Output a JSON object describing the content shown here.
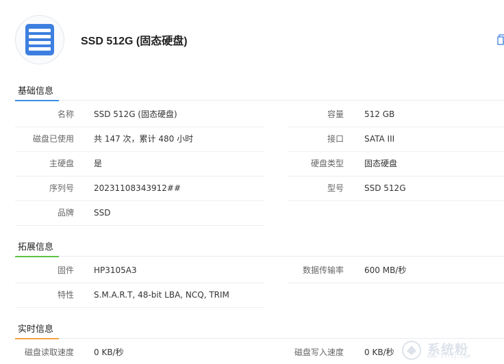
{
  "device": {
    "title": "SSD 512G (固态硬盘)",
    "icon": "ssd-icon",
    "accent": "#3d7fe0"
  },
  "sections": {
    "basic": {
      "title": "基础信息",
      "accent": "#3a8ee6",
      "rows": [
        {
          "l_label": "名称",
          "l_value": "SSD 512G (固态硬盘)",
          "r_label": "容量",
          "r_value": "512 GB"
        },
        {
          "l_label": "磁盘已使用",
          "l_value": "共 147 次，累计 480 小时",
          "r_label": "接口",
          "r_value": "SATA III"
        },
        {
          "l_label": "主硬盘",
          "l_value": "是",
          "r_label": "硬盘类型",
          "r_value": "固态硬盘"
        },
        {
          "l_label": "序列号",
          "l_value": "20231108343912##",
          "r_label": "型号",
          "r_value": "SSD 512G"
        },
        {
          "l_label": "品牌",
          "l_value": "SSD"
        }
      ]
    },
    "extended": {
      "title": "拓展信息",
      "accent": "#5cc242",
      "rows": [
        {
          "l_label": "固件",
          "l_value": "HP3105A3",
          "r_label": "数据传输率",
          "r_value": "600 MB/秒"
        },
        {
          "l_label": "特性",
          "l_value": "S.M.A.R.T, 48-bit LBA, NCQ, TRIM"
        }
      ]
    },
    "realtime": {
      "title": "实时信息",
      "accent": "#f0a040",
      "rows": [
        {
          "l_label": "磁盘读取速度",
          "l_value": "0 KB/秒",
          "r_label": "磁盘写入速度",
          "r_value": "0 KB/秒"
        }
      ]
    }
  },
  "watermark": {
    "text": "系统粉",
    "url": "www.xtfsj.com"
  }
}
